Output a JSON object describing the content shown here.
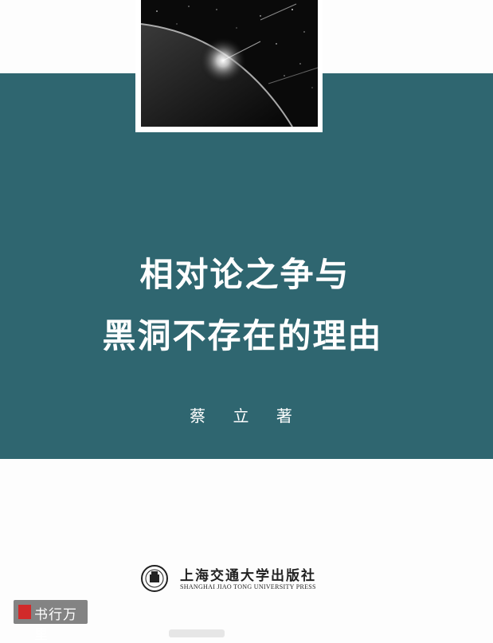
{
  "cover": {
    "title_line1": "相对论之争与",
    "title_line2": "黑洞不存在的理由",
    "author": "蔡 立 著",
    "publisher_cn": "上海交通大学出版社",
    "publisher_en": "SHANGHAI JIAO TONG UNIVERSITY PRESS",
    "watermark": "书行万里"
  },
  "colors": {
    "band": "#2f6670",
    "title_text": "#ffffff",
    "seal_red": "#d12a2a"
  },
  "icons": [
    "university-seal-icon",
    "watermark-seal-icon"
  ]
}
